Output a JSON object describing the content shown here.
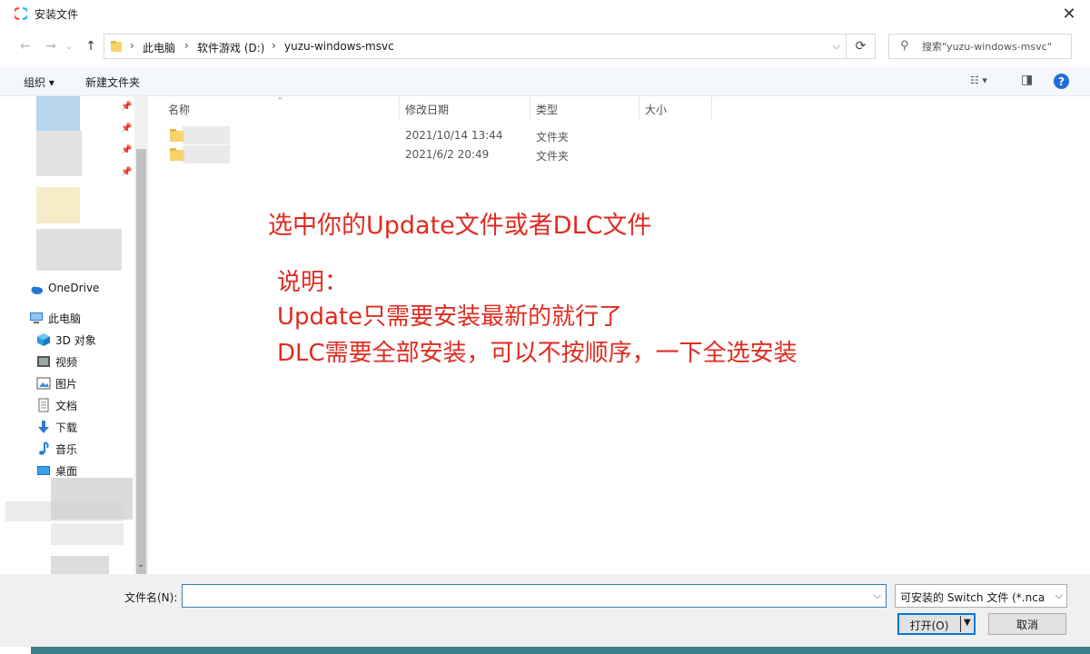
{
  "window": {
    "title": "安装文件",
    "close_glyph": "✕"
  },
  "nav": {
    "back_glyph": "←",
    "forward_glyph": "→",
    "recent_glyph": "⌄",
    "up_glyph": "↑",
    "breadcrumbs": [
      "此电脑",
      "软件游戏 (D:)",
      "yuzu-windows-msvc"
    ],
    "separator": "›",
    "refresh_glyph": "⟳",
    "dropdown_glyph": "⌵"
  },
  "search": {
    "placeholder": "搜索\"yuzu-windows-msvc\"",
    "icon_glyph": "⚲"
  },
  "toolbar": {
    "organize_label": "组织 ▾",
    "new_folder_label": "新建文件夹",
    "view_glyph": "☷ ▾",
    "pane_glyph": "◨",
    "help_glyph": "?"
  },
  "sidebar": {
    "pin_glyph": "📌",
    "items": [
      {
        "label": "OneDrive",
        "icon": "cloud-icon"
      },
      {
        "label": "此电脑",
        "icon": "computer-icon"
      },
      {
        "label": "3D 对象",
        "icon": "cube-icon"
      },
      {
        "label": "视频",
        "icon": "video-icon"
      },
      {
        "label": "图片",
        "icon": "picture-icon"
      },
      {
        "label": "文档",
        "icon": "document-icon"
      },
      {
        "label": "下载",
        "icon": "download-icon"
      },
      {
        "label": "音乐",
        "icon": "music-icon"
      },
      {
        "label": "桌面",
        "icon": "desktop-icon"
      }
    ]
  },
  "columns": {
    "name": "名称",
    "modified": "修改日期",
    "type": "类型",
    "size": "大小",
    "sort_glyph": "^"
  },
  "files": [
    {
      "modified": "2021/10/14 13:44",
      "type": "文件夹"
    },
    {
      "modified": "2021/6/2 20:49",
      "type": "文件夹"
    }
  ],
  "annotations": {
    "title": "选中你的Update文件或者DLC文件",
    "note_heading": "说明：",
    "note_line1": "Update只需要安装最新的就行了",
    "note_line2": "DLC需要全部安装，可以不按顺序，一下全选安装"
  },
  "footer": {
    "filename_label": "文件名(N):",
    "filename_value": "",
    "filter_value": "可安装的 Switch 文件 (*.nca *.",
    "open_label": "打开(O)",
    "cancel_label": "取消",
    "dropdown_glyph": "⌵"
  },
  "colors": {
    "accent": "#0078d7",
    "annotation": "#e02b20",
    "taskbar": "#3a7f86"
  }
}
